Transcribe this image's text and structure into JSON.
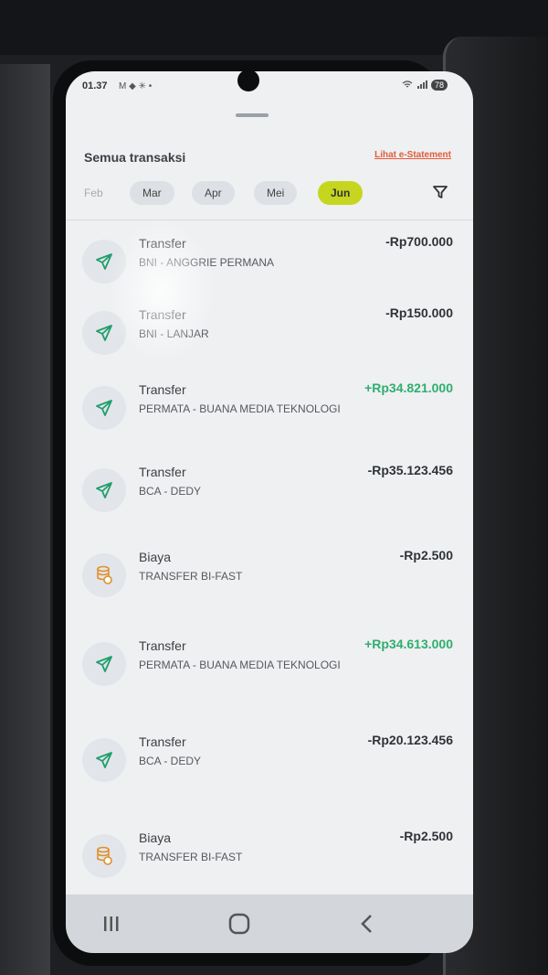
{
  "status_bar": {
    "time": "01.37",
    "notif_icons": "M ◆ ✳ •",
    "battery": "78"
  },
  "header": {
    "title": "Semua transaksi",
    "statement_link": "Lihat e-Statement"
  },
  "months": [
    "Feb",
    "Mar",
    "Apr",
    "Mei",
    "Jun"
  ],
  "active_month": "Jun",
  "transactions": [
    {
      "type": "Transfer",
      "detail": "BNI - ANGGRIE PERMANA",
      "amount": "-Rp700.000",
      "direction": "out",
      "icon": "send-icon"
    },
    {
      "type": "Transfer",
      "detail": "BNI - LANJAR",
      "amount": "-Rp150.000",
      "direction": "out",
      "icon": "send-icon"
    },
    {
      "type": "Transfer",
      "detail": "PERMATA - BUANA MEDIA TEKNOLOGI",
      "amount": "+Rp34.821.000",
      "direction": "in",
      "icon": "send-icon"
    },
    {
      "type": "Transfer",
      "detail": "BCA - DEDY",
      "amount": "-Rp35.123.456",
      "direction": "out",
      "icon": "send-icon"
    },
    {
      "type": "Biaya",
      "detail": "TRANSFER BI-FAST",
      "amount": "-Rp2.500",
      "direction": "out",
      "icon": "coins-icon"
    },
    {
      "type": "Transfer",
      "detail": "PERMATA - BUANA MEDIA TEKNOLOGI",
      "amount": "+Rp34.613.000",
      "direction": "in",
      "icon": "send-icon"
    },
    {
      "type": "Transfer",
      "detail": "BCA - DEDY",
      "amount": "-Rp20.123.456",
      "direction": "out",
      "icon": "send-icon"
    },
    {
      "type": "Biaya",
      "detail": "TRANSFER BI-FAST",
      "amount": "-Rp2.500",
      "direction": "out",
      "icon": "coins-icon"
    }
  ],
  "colors": {
    "positive": "#2fae6e",
    "negative": "#2f3237",
    "accent_month": "#c6d620",
    "link": "#e25b39",
    "icon_green": "#1f9e6b",
    "icon_orange": "#e0902a"
  },
  "nav": {
    "recents": "recent-apps-icon",
    "home": "home-icon",
    "back": "back-icon"
  }
}
